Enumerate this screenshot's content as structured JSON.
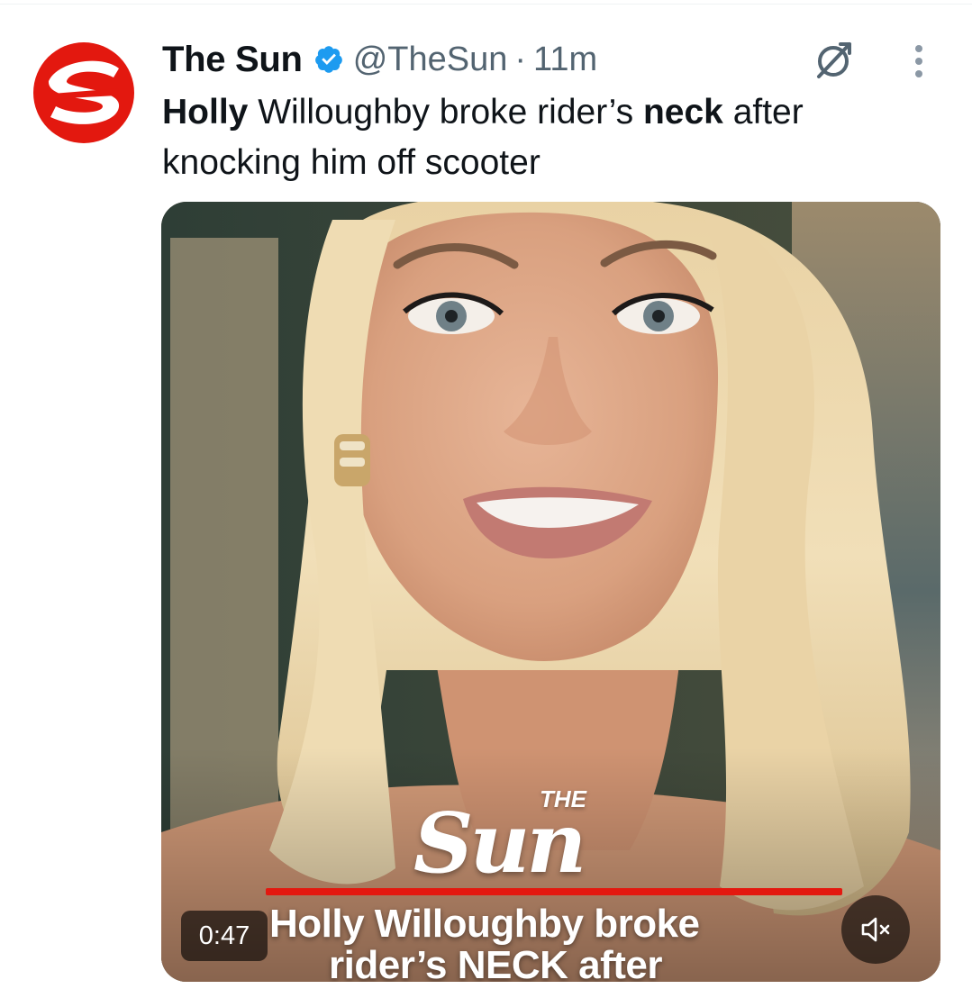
{
  "tweet": {
    "author_name": "The Sun",
    "handle": "@TheSun",
    "separator": "·",
    "time": "11m",
    "text": {
      "w1": "Holly",
      "w2": " Willoughby broke rider’s ",
      "w3": "neck",
      "w4": " after knocking him off scooter"
    },
    "icons": {
      "avatar": "the-sun-logo-avatar",
      "verified": "verified-badge-icon",
      "grok": "grok-icon",
      "more": "more-options-icon"
    }
  },
  "media": {
    "logo_the": "THE",
    "logo_sun": "Sun",
    "caption_line1": "Holly Willoughby broke",
    "caption_line2": "rider’s NECK after",
    "duration": "0:47",
    "mute_icon": "speaker-muted-icon"
  },
  "colors": {
    "text_primary": "#0f1419",
    "text_secondary": "#536471",
    "verified_blue": "#1d9bf0",
    "brand_red": "#e3180f"
  }
}
